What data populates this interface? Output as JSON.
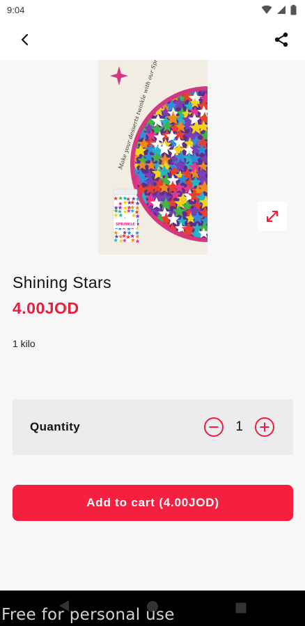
{
  "status_bar": {
    "time": "9:04"
  },
  "product": {
    "name": "Shining Stars",
    "price": "4.00JOD",
    "description": "1 kilo",
    "image_text": "Make your desserts twinkle with our Sprinkles",
    "jar_label": "SPRINKLE"
  },
  "quantity": {
    "label": "Quantity",
    "value": "1"
  },
  "cart": {
    "button_label": "Add to cart (4.00JOD)"
  },
  "watermark": "Free for personal use",
  "icons": {
    "back": "arrow-back-icon",
    "share": "share-icon",
    "expand": "expand-icon",
    "minus": "minus-circle-icon",
    "plus": "plus-circle-icon"
  },
  "colors": {
    "accent": "#f5203f",
    "price": "#ee1b3c",
    "quantity_bg": "#ececef"
  }
}
